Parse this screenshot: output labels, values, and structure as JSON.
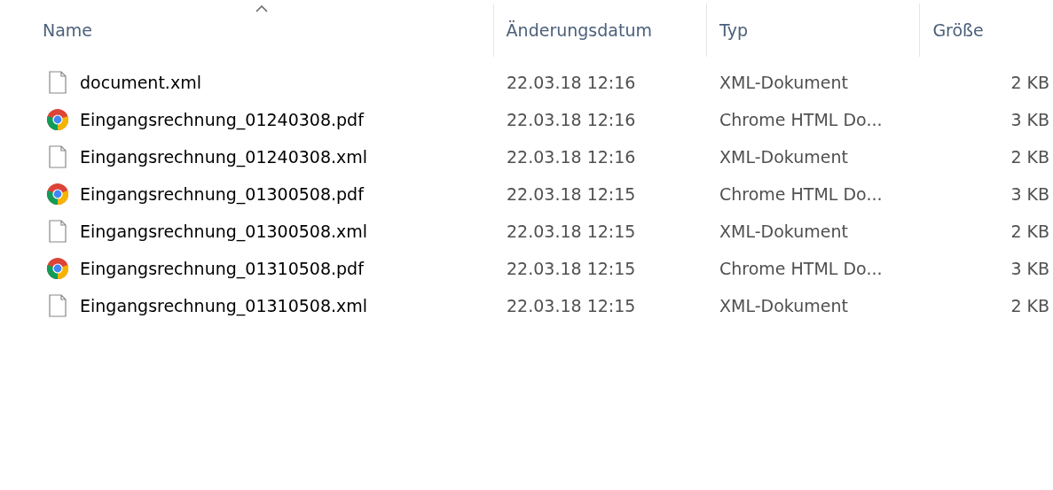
{
  "columns": [
    {
      "label": "Name",
      "sorted": true
    },
    {
      "label": "Änderungsdatum",
      "sorted": false
    },
    {
      "label": "Typ",
      "sorted": false
    },
    {
      "label": "Größe",
      "sorted": false
    }
  ],
  "rows": [
    {
      "kind": "file",
      "name": "document.xml",
      "date": "22.03.18 12:16",
      "type": "XML-Dokument",
      "size": "2 KB"
    },
    {
      "kind": "chrome",
      "name": "Eingangsrechnung_01240308.pdf",
      "date": "22.03.18 12:16",
      "type": "Chrome HTML Do...",
      "size": "3 KB"
    },
    {
      "kind": "file",
      "name": "Eingangsrechnung_01240308.xml",
      "date": "22.03.18 12:16",
      "type": "XML-Dokument",
      "size": "2 KB"
    },
    {
      "kind": "chrome",
      "name": "Eingangsrechnung_01300508.pdf",
      "date": "22.03.18 12:15",
      "type": "Chrome HTML Do...",
      "size": "3 KB"
    },
    {
      "kind": "file",
      "name": "Eingangsrechnung_01300508.xml",
      "date": "22.03.18 12:15",
      "type": "XML-Dokument",
      "size": "2 KB"
    },
    {
      "kind": "chrome",
      "name": "Eingangsrechnung_01310508.pdf",
      "date": "22.03.18 12:15",
      "type": "Chrome HTML Do...",
      "size": "3 KB"
    },
    {
      "kind": "file",
      "name": "Eingangsrechnung_01310508.xml",
      "date": "22.03.18 12:15",
      "type": "XML-Dokument",
      "size": "2 KB"
    }
  ]
}
